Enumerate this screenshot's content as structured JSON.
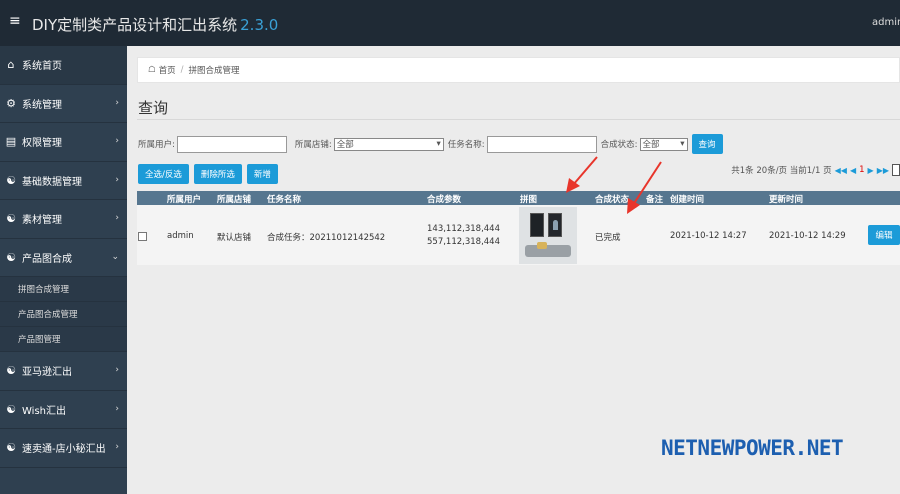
{
  "header": {
    "title": "DIY定制类产品设计和汇出系统",
    "version": "2.3.0",
    "user": "admin"
  },
  "sidebar": {
    "items": [
      {
        "label": "系统首页",
        "icon": "home-icon"
      },
      {
        "label": "系统管理",
        "icon": "gear-icon"
      },
      {
        "label": "权限管理",
        "icon": "id-card-icon"
      },
      {
        "label": "基础数据管理",
        "icon": "sitemap-icon"
      },
      {
        "label": "素材管理",
        "icon": "sitemap-icon"
      },
      {
        "label": "产品图合成",
        "icon": "sitemap-icon"
      },
      {
        "label": "亚马逊汇出",
        "icon": "sitemap-icon"
      },
      {
        "label": "Wish汇出",
        "icon": "sitemap-icon"
      },
      {
        "label": "速卖通-店小秘汇出",
        "icon": "sitemap-icon"
      }
    ],
    "sub_items": [
      "拼图合成管理",
      "产品图合成管理",
      "产品图管理"
    ]
  },
  "breadcrumb": {
    "home": "首页",
    "current": "拼图合成管理"
  },
  "page": {
    "title": "查询"
  },
  "filters": {
    "user_label": "所属用户:",
    "user_value": "",
    "shop_label": "所属店铺:",
    "shop_value": "全部",
    "task_label": "任务名称:",
    "task_value": "",
    "status_label": "合成状态:",
    "status_value": "全部",
    "search_button": "查询"
  },
  "actions": {
    "select_all": "全选/反选",
    "delete_selected": "删除所选",
    "add": "新增"
  },
  "pager": {
    "summary": "共1条 20条/页 当前1/1 页",
    "current": "1"
  },
  "table": {
    "columns": [
      "所属用户",
      "所属店铺",
      "任务名称",
      "合成参数",
      "拼图",
      "合成状态",
      "备注",
      "创建时间",
      "更新时间"
    ],
    "rows": [
      {
        "user": "admin",
        "shop": "默认店铺",
        "task": "合成任务：20211012142542",
        "params_line1": "143,112,318,444",
        "params_line2": "557,112,318,444",
        "status": "已完成",
        "note": "",
        "created": "2021-10-12 14:27",
        "updated": "2021-10-12 14:29",
        "edit_label": "编辑"
      }
    ]
  },
  "watermark": "NETNEWPOWER.NET",
  "colors": {
    "topbar": "#1f2a35",
    "sidebar": "#2f4050",
    "accent": "#1c9bd8",
    "table_header": "#56768f",
    "arrow": "#e8352b",
    "watermark": "#1d5fb0"
  }
}
